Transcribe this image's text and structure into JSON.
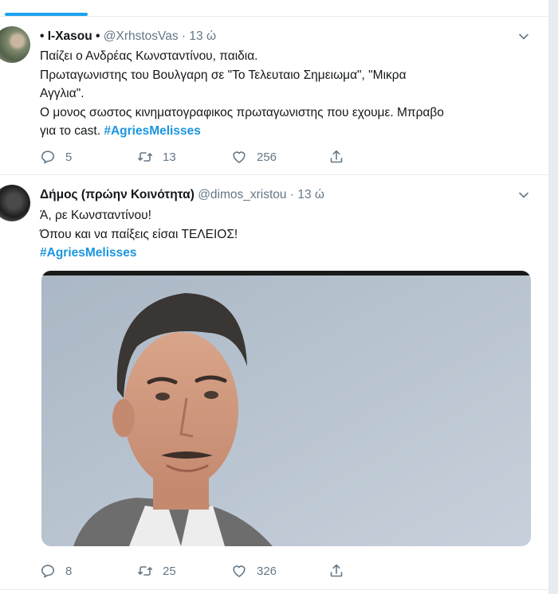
{
  "tweets": [
    {
      "author_name": "• I-Xasou •",
      "handle": "@XrhstosVas",
      "separator": "·",
      "time": "13 ώ",
      "lines": [
        "Παίζει ο Ανδρέας Κωνσταντίνου, παιδια.",
        "Πρωταγωνιστης του Βουλγαρη σε \"Το Τελευταιο Σημειωμα\", \"Μικρα",
        "Αγγλια\".",
        "Ο μονος σωστος κινηματογραφικος πρωταγωνιστης που εχουμε. Μπραβο",
        "για το cast. "
      ],
      "hashtag": "#AgriesMelisses",
      "reply_count": "5",
      "retweet_count": "13",
      "like_count": "256"
    },
    {
      "author_name": "Δήμος (πρώην Κοινότητα)",
      "handle": "@dimos_xristou",
      "separator": "·",
      "time": "13 ώ",
      "lines": [
        "Ά, ρε Κωνσταντίνου!",
        "Όπου και να παίξεις είσαι ΤΕΛΕΙΟΣ!"
      ],
      "hashtag": "#AgriesMelisses",
      "reply_count": "8",
      "retweet_count": "25",
      "like_count": "326"
    }
  ],
  "icons": {
    "reply": "reply-icon",
    "retweet": "retweet-icon",
    "like": "heart-icon",
    "share": "share-icon",
    "menu": "chevron-down-icon"
  },
  "colors": {
    "text": "#14171a",
    "secondary": "#657786",
    "link": "#1b95e0",
    "accent": "#1da1f2",
    "divider": "#e6ecf0"
  }
}
